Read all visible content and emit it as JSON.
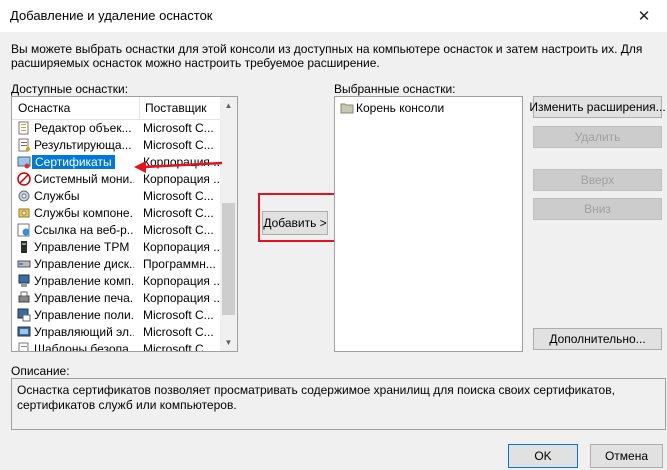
{
  "window": {
    "title": "Добавление и удаление оснасток",
    "close_glyph": "✕"
  },
  "intro_text": "Вы можете выбрать оснастки для этой консоли из доступных на компьютере оснасток и затем настроить их. Для расширяемых оснасток можно настроить требуемое расширение.",
  "available": {
    "label": "Доступные оснастки:",
    "col_snapin": "Оснастка",
    "col_vendor": "Поставщик",
    "items": [
      {
        "name": "Редактор объек...",
        "vendor": "Microsoft C...",
        "icon": "object-editor-icon"
      },
      {
        "name": "Результирующа...",
        "vendor": "Microsoft C...",
        "icon": "rsop-icon"
      },
      {
        "name": "Сертификаты",
        "vendor": "Корпорация ...",
        "icon": "certificates-icon",
        "selected": true
      },
      {
        "name": "Системный мони...",
        "vendor": "Корпорация ...",
        "icon": "performance-monitor-icon"
      },
      {
        "name": "Службы",
        "vendor": "Microsoft C...",
        "icon": "services-icon"
      },
      {
        "name": "Службы компоне...",
        "vendor": "Microsoft C...",
        "icon": "component-services-icon"
      },
      {
        "name": "Ссылка на веб-р...",
        "vendor": "Microsoft C...",
        "icon": "web-link-icon"
      },
      {
        "name": "Управление TPM",
        "vendor": "Корпорация ...",
        "icon": "tpm-icon"
      },
      {
        "name": "Управление диск...",
        "vendor": "Программн...",
        "icon": "disk-management-icon"
      },
      {
        "name": "Управление комп...",
        "vendor": "Корпорация ...",
        "icon": "computer-management-icon"
      },
      {
        "name": "Управление печа...",
        "vendor": "Корпорация ...",
        "icon": "print-management-icon"
      },
      {
        "name": "Управление поли...",
        "vendor": "Microsoft C...",
        "icon": "policy-management-icon"
      },
      {
        "name": "Управляющий эл...",
        "vendor": "Microsoft C...",
        "icon": "activex-icon"
      },
      {
        "name": "Шаблоны безопа...",
        "vendor": "Microsoft C...",
        "icon": "security-templates-icon"
      }
    ]
  },
  "add_button": "Добавить >",
  "selected": {
    "label": "Выбранные оснастки:",
    "root": "Корень консоли"
  },
  "buttons": {
    "edit_extensions": "Изменить расширения...",
    "remove": "Удалить",
    "up": "Вверх",
    "down": "Вниз",
    "advanced": "Дополнительно...",
    "ok": "OK",
    "cancel": "Отмена"
  },
  "description": {
    "label": "Описание:",
    "text": "Оснастка сертификатов позволяет просматривать содержимое хранилищ для поиска своих сертификатов, сертификатов служб или компьютеров."
  },
  "colors": {
    "accent": "#0078d7",
    "highlight": "#e6121c"
  }
}
